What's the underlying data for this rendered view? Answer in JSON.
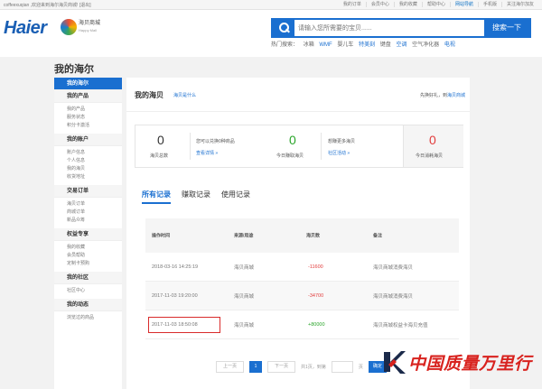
{
  "topbar": {
    "welcome": "coffeexuqian ,欢迎来到海尔海贝商城! [退出]",
    "links": [
      "我的订单",
      "会员中心",
      "我的收藏",
      "帮助中心",
      "网站导航",
      "手机版",
      "关注海尔加友"
    ]
  },
  "header": {
    "logo": "Haier",
    "mall_name": "海贝商城",
    "mall_en": "Happy Mall",
    "search_placeholder": "请输入您所需要的宝贝......",
    "search_button": "搜索一下",
    "hot_label": "热门搜索：",
    "hot_items": [
      "冰箱",
      "WMF",
      "婴儿车",
      "特美刻",
      "键盘",
      "空调",
      "空气净化器",
      "电视"
    ]
  },
  "page_title": "我的海尔",
  "sidebar": {
    "groups": [
      {
        "title": "我的海尔",
        "active": true,
        "items": []
      },
      {
        "title": "我的产品",
        "active": false,
        "items": [
          "我的产品",
          "服务状态",
          "积分卡激活"
        ]
      },
      {
        "title": "我的账户",
        "active": false,
        "items": [
          "账户信息",
          "个人信息",
          "我的海贝",
          "收货地址"
        ]
      },
      {
        "title": "交易订单",
        "active": false,
        "items": [
          "海贝订单",
          "商城订单",
          "新品众筹"
        ]
      },
      {
        "title": "权益专享",
        "active": false,
        "items": [
          "我的收藏",
          "会员帮助",
          "定制卡预购"
        ]
      },
      {
        "title": "我的社区",
        "active": false,
        "items": [
          "社区中心"
        ]
      },
      {
        "title": "我的动态",
        "active": false,
        "items": [
          "浏览过的商品"
        ]
      }
    ]
  },
  "main": {
    "title": "我的海贝",
    "what_link": "海贝是什么",
    "right_text": "先换好礼，到",
    "right_link": "海贝商城",
    "stats": {
      "total": {
        "value": "0",
        "label": "海贝总数"
      },
      "total_desc": "您可以兑换0种商品",
      "total_link": "查看详情 »",
      "today_earn": {
        "value": "0",
        "label": "今日赚取海贝"
      },
      "earn_desc": "想赚更多海贝",
      "earn_link": "社区活动 »",
      "today_spend": {
        "value": "0",
        "label": "今日消耗海贝"
      }
    },
    "tabs": [
      "所有记录",
      "赚取记录",
      "使用记录"
    ],
    "table": {
      "headers": [
        "操作时间",
        "来源/用途",
        "海贝数",
        "备注"
      ],
      "rows": [
        {
          "time": "2018-03-16 14:25:19",
          "source": "海贝商城",
          "amount": "-11600",
          "note": "海贝商城消费海贝"
        },
        {
          "time": "2017-11-03 19:20:00",
          "source": "海贝商城",
          "amount": "-34700",
          "note": "海贝商城消费海贝"
        },
        {
          "time": "2017-11-03 18:50:08",
          "source": "海贝商城",
          "amount": "+80000",
          "note": "海贝商城权益卡海贝充值"
        }
      ]
    },
    "pager": {
      "prev": "上一页",
      "current": "1",
      "next": "下一页",
      "total_pages": "共1页，到第",
      "page_unit": "页",
      "ok": "确定"
    }
  },
  "watermark": {
    "text": "中国质量万里行"
  },
  "colors": {
    "brand": "#1a6fd0",
    "negative": "#e23c3c",
    "positive": "#2aa52a",
    "highlight": "#d92b2b",
    "watermark": "#d8221e"
  }
}
